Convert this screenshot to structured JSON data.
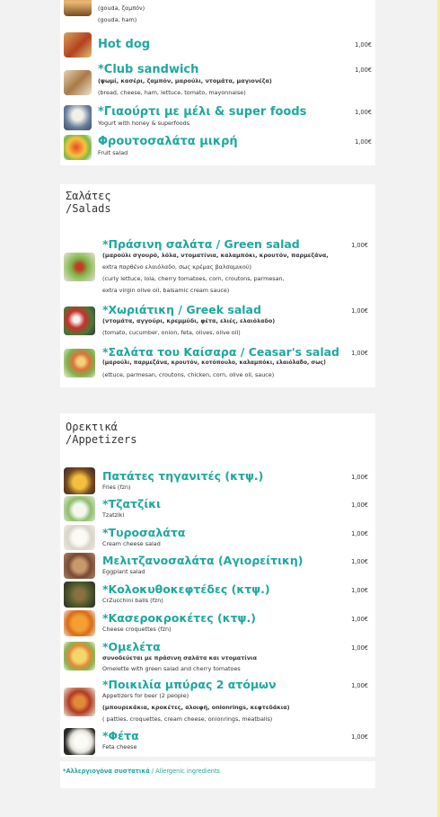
{
  "sandwich_card": {
    "top_sub": "(gouda, ζαμπόν)",
    "top_sub_en": "(gouda, ham)",
    "items": [
      {
        "title": "Hot dog",
        "price": "1,00€",
        "sub1": "",
        "sub2": ""
      },
      {
        "title": "*Club sandwich",
        "price": "1,00€",
        "sub1": "(ψωμί, κασέρι, ζαμπόν, μαρούλι, ντομάτα, μαγιονέζα)",
        "sub2": "(bread, cheese, ham, lettuce, tomato, mayonnaise)"
      },
      {
        "title": "*Γιαούρτι με μέλι & super foods",
        "price": "1,00€",
        "sub1": "Yogurt with honey & superfoods",
        "sub2": ""
      },
      {
        "title": "Φρουτοσαλάτα μικρή",
        "price": "1,00€",
        "sub1": "Fruit salad",
        "sub2": ""
      }
    ]
  },
  "salads": {
    "heading_line1": "Σαλάτες",
    "heading_line2": "/Salads",
    "items": [
      {
        "title": "*Πράσινη σαλάτα / Green salad",
        "price": "1,00€",
        "gr1": "(μαρούλι σγουρό, λόλα, ντοματίνια, καλαμπόκι, κρουτόν, παρμεζάνα,",
        "gr2": "extra παρθένο ελαιόλαδο, σως κρέμας βαλσαμικού)",
        "en1": "(curly lettuce, lola, cherry tomatoes, corn, croutons, parmesan,",
        "en2": "extra virgin olive oil, balsamic cream sauce)"
      },
      {
        "title": "*Χωριάτικη / Greek salad",
        "price": "1,00€",
        "gr1": "(ντομάτα, αγγούρι, κρεμμύδι, φέτα, ελιές, ελαιόλαδο)",
        "en1": "(tomato, cucumber, onion, feta, olives, olive oil)"
      },
      {
        "title": "*Σαλάτα του Καίσαρα / Ceasar's salad",
        "price": "1,00€",
        "gr1": "(μαρούλι, παρμεζάνα, κρουτόν, κοτόπουλο, καλαμπόκι, ελαιόλαδο, σως)",
        "en1": "(ettuce, parmesan, croutons, chicken, corn, olive oil, sauce)"
      }
    ]
  },
  "appetizers": {
    "heading_line1": "Ορεκτικά",
    "heading_line2": "/Appetizers",
    "items": [
      {
        "title": "Πατάτες τηγανιτές (κτψ.)",
        "price": "1,00€",
        "sub1": "Fries (fzn)"
      },
      {
        "title": "*Τζατζίκι",
        "price": "1,00€",
        "sub1": "Tzatziki"
      },
      {
        "title": "*Τυροσαλάτα",
        "price": "1,00€",
        "sub1": "Cream cheese salad"
      },
      {
        "title": "Μελιτζανοσαλάτα (Αγιορείτικη)",
        "price": "1,00€",
        "sub1": "Eggplant salad"
      },
      {
        "title": "*Κολοκυθοκεφτέδες (κτψ.)",
        "price": "1,00€",
        "sub1": "CrZucchini balls (fzn)"
      },
      {
        "title": "*Κασεροκροκέτες (κτψ.)",
        "price": "1,00€",
        "sub1": "Cheese croquettes (fzn)"
      },
      {
        "title": "*Ομελέτα",
        "price": "1,00€",
        "sub0": "συνοδεύεται με πράσινη σαλάτα και ντοματίνια",
        "sub1": "Omelette with green salad and cherry tomatoes"
      },
      {
        "title": "*Ποικιλία μπύρας 2 ατόμων",
        "price": "1,00€",
        "sub1": "Appetizers for beer (2 people)",
        "sub2": "(μπουρεκάκια, κροκέτες, αλοιφή, onionrings, κεφτεδάκια)",
        "sub3": "( patties, croquettes, cream cheese, onionrings, meatballs)"
      },
      {
        "title": "*Φέτα",
        "price": "1,00€",
        "sub1": "Feta cheese"
      }
    ]
  },
  "footer": {
    "allergen_gr": "*Αλλεργιογόνα συστατικά",
    "allergen_en": " / Allergenic ingredients"
  },
  "colors": {
    "accent": "#1fa7a0",
    "background": "#f2f2f2",
    "card": "#ffffff"
  }
}
